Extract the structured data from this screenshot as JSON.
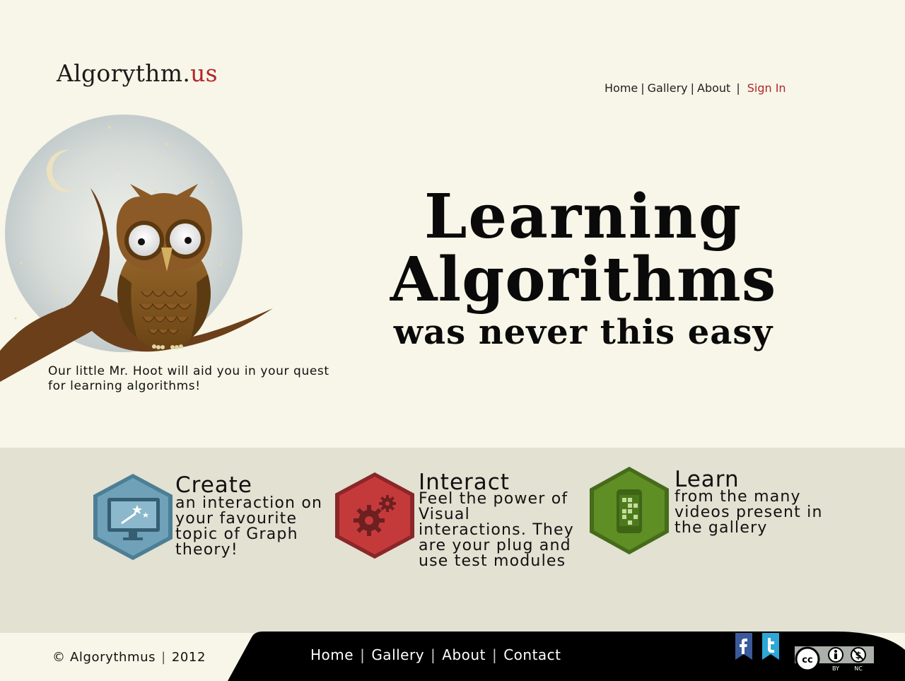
{
  "header": {
    "logo_main": "Algorythm",
    "logo_dot": ".",
    "logo_tld": "us",
    "nav": {
      "home": "Home",
      "gallery": "Gallery",
      "about": "About",
      "signin": "Sign In",
      "separator": "|"
    }
  },
  "hero": {
    "title_line1": "Learning",
    "title_line2": "Algorithms",
    "title_line3": "was never this easy",
    "caption": "Our little Mr. Hoot will aid you in your quest for learning algorithms!",
    "mascot_icon": "owl-on-branch-icon"
  },
  "features": [
    {
      "title": "Create",
      "description_lines": [
        "an interaction on",
        "your favourite",
        "topic of Graph",
        "theory!"
      ],
      "icon": "monitor-wand-icon",
      "color": "#6a9db4"
    },
    {
      "title": "Interact",
      "description_lines": [
        "Feel the power of",
        "Visual",
        "interactions. They",
        "are your plug and",
        "use test modules"
      ],
      "icon": "gears-icon",
      "color": "#c0393a"
    },
    {
      "title": "Learn",
      "description_lines": [
        "from the many",
        "videos present in",
        "the gallery"
      ],
      "icon": "phone-grid-icon",
      "color": "#5f8e25"
    }
  ],
  "footer": {
    "copyright_symbol": "©",
    "copyright_name": "Algorythmus",
    "copyright_year": "2012",
    "separator": "|",
    "nav": {
      "home": "Home",
      "gallery": "Gallery",
      "about": "About",
      "contact": "Contact"
    },
    "social": [
      "facebook-icon",
      "twitter-icon"
    ],
    "license": {
      "cc": "cc",
      "by": "BY",
      "nc": "NC"
    }
  },
  "colors": {
    "background": "#f7f6e8",
    "band": "#e2e1d2",
    "footer": "#000000",
    "accent": "#b3262b"
  }
}
